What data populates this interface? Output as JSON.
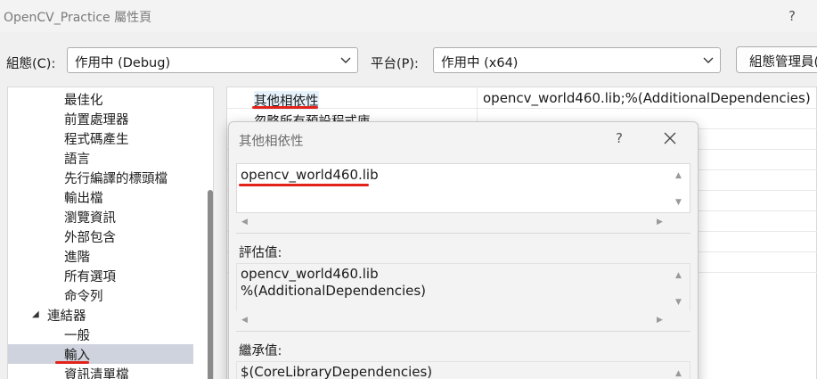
{
  "window": {
    "title": "OpenCV_Practice 屬性頁",
    "help": "?"
  },
  "config": {
    "configuration_label": "組態(C):",
    "configuration_value": "作用中 (Debug)",
    "platform_label": "平台(P):",
    "platform_value": "作用中 (x64)",
    "manager_button": "組態管理員("
  },
  "tree": {
    "items": [
      {
        "label": "最佳化"
      },
      {
        "label": "前置處理器"
      },
      {
        "label": "程式碼產生"
      },
      {
        "label": "語言"
      },
      {
        "label": "先行編譯的標頭檔"
      },
      {
        "label": "輸出檔"
      },
      {
        "label": "瀏覽資訊"
      },
      {
        "label": "外部包含"
      },
      {
        "label": "進階"
      },
      {
        "label": "所有選項"
      },
      {
        "label": "命令列"
      },
      {
        "label": "連結器",
        "toggle": "◢"
      },
      {
        "label": "一般"
      },
      {
        "label": "輸入"
      },
      {
        "label": "資訊清單檔"
      }
    ]
  },
  "grid": {
    "rows": [
      {
        "name": "其他相依性",
        "value": "opencv_world460.lib;%(AdditionalDependencies)"
      },
      {
        "name": "忽略所有預設程式庫",
        "value": ""
      }
    ]
  },
  "dialog": {
    "title": "其他相依性",
    "help": "?",
    "edit_value": "opencv_world460.lib",
    "evaluated_label": "評估值:",
    "evaluated_lines": [
      "opencv_world460.lib",
      "%(AdditionalDependencies)"
    ],
    "inherited_label": "繼承值:",
    "inherited_lines": [
      "$(CoreLibraryDependencies)"
    ]
  },
  "colors": {
    "annotation_red": "#e2231a",
    "selection": "#cfd3dd"
  }
}
